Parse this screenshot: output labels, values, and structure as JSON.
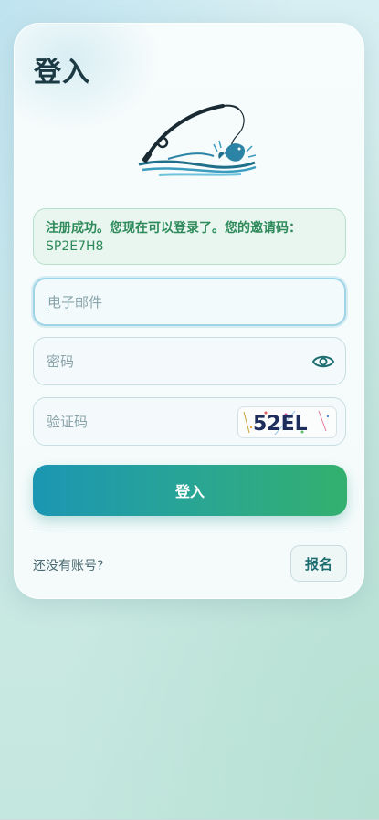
{
  "login": {
    "title": "登入",
    "alert": {
      "message": "注册成功。您现在可以登录了。您的邀请码：",
      "code": "SP2E7H8"
    },
    "email_placeholder": "电子邮件",
    "password_placeholder": "密码",
    "captcha_placeholder": "验证码",
    "captcha_text": "52EL",
    "submit_label": "登入",
    "no_account_text": "还没有账号?",
    "signup_label": "报名"
  },
  "icons": {
    "logo": "fishing-rod-fish-logo",
    "password_toggle": "eye-icon"
  },
  "colors": {
    "title": "#1c3a44",
    "success_text": "#2f8a5b",
    "button_gradient_start": "#1b96b3",
    "button_gradient_end": "#33b06e",
    "signup_text": "#1d6d71"
  }
}
